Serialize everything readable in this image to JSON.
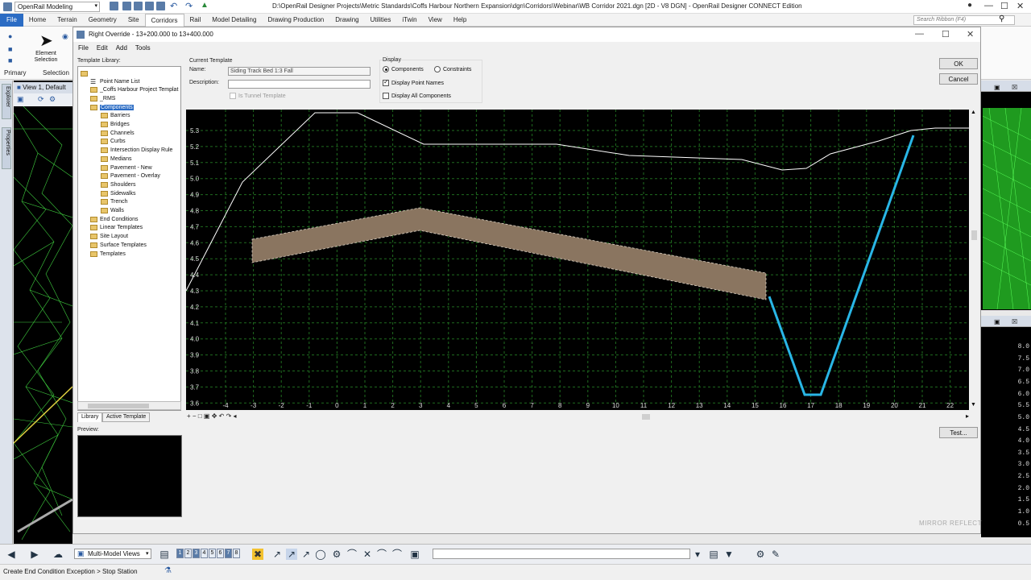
{
  "window": {
    "workspace": "OpenRail Modeling",
    "title": "D:\\OpenRail Designer Projects\\Metric Standards\\Coffs Harbour Northern Expansion\\dgn\\Corridors\\Webinar\\WB Corridor 2021.dgn [2D - V8 DGN] - OpenRail Designer CONNECT Edition",
    "minimize": "—",
    "maximize": "☐",
    "close": "✕"
  },
  "ribbon": {
    "tabs": [
      "File",
      "Home",
      "Terrain",
      "Geometry",
      "Site",
      "Corridors",
      "Rail",
      "Model Detailing",
      "Drawing Production",
      "Drawing",
      "Utilities",
      "iTwin",
      "View",
      "Help"
    ],
    "active_tab": "Corridors",
    "search_placeholder": "Search Ribbon (F4)",
    "element_selection": "Element Selection",
    "groups": [
      "Primary",
      "Selection"
    ]
  },
  "left_panel": {
    "tabs": [
      "Explorer",
      "Properties"
    ]
  },
  "view1": {
    "title": "View 1, Default"
  },
  "dialog": {
    "title": "Right Override - 13+200.000 to 13+400.000",
    "menu": [
      "File",
      "Edit",
      "Add",
      "Tools"
    ],
    "template_library_label": "Template Library:",
    "tree": [
      {
        "label": "Point Name List",
        "level": 1,
        "icon": "list-icon"
      },
      {
        "label": "_Coffs Harbour Project Templat",
        "level": 1,
        "icon": "folder-icon"
      },
      {
        "label": "_RMS",
        "level": 1,
        "icon": "folder-icon"
      },
      {
        "label": "Components",
        "level": 1,
        "icon": "folder-icon",
        "selected": true
      },
      {
        "label": "Barriers",
        "level": 2,
        "icon": "folder-icon"
      },
      {
        "label": "Bridges",
        "level": 2,
        "icon": "folder-icon"
      },
      {
        "label": "Channels",
        "level": 2,
        "icon": "folder-icon"
      },
      {
        "label": "Curbs",
        "level": 2,
        "icon": "folder-icon"
      },
      {
        "label": "Intersection Display Rule",
        "level": 2,
        "icon": "folder-icon"
      },
      {
        "label": "Medians",
        "level": 2,
        "icon": "folder-icon"
      },
      {
        "label": "Pavement - New",
        "level": 2,
        "icon": "folder-icon"
      },
      {
        "label": "Pavement - Overlay",
        "level": 2,
        "icon": "folder-icon"
      },
      {
        "label": "Shoulders",
        "level": 2,
        "icon": "folder-icon"
      },
      {
        "label": "Sidewalks",
        "level": 2,
        "icon": "folder-icon"
      },
      {
        "label": "Trench",
        "level": 2,
        "icon": "folder-icon"
      },
      {
        "label": "Walls",
        "level": 2,
        "icon": "folder-icon"
      },
      {
        "label": "End Conditions",
        "level": 1,
        "icon": "folder-icon"
      },
      {
        "label": "Linear Templates",
        "level": 1,
        "icon": "folder-icon"
      },
      {
        "label": "Site Layout",
        "level": 1,
        "icon": "folder-icon"
      },
      {
        "label": "Surface Templates",
        "level": 1,
        "icon": "folder-icon"
      },
      {
        "label": "Templates",
        "level": 1,
        "icon": "folder-icon"
      }
    ],
    "bottom_tabs": [
      "Library",
      "Active Template"
    ],
    "active_bottom_tab": "Library",
    "preview_label": "Preview:",
    "current_template": {
      "group_label": "Current Template",
      "name_label": "Name:",
      "name_value": "Siding Track Bed 1:3 Fall",
      "description_label": "Description:",
      "description_value": "",
      "tunnel_label": "Is Tunnel Template",
      "tunnel_checked": false
    },
    "display": {
      "group_label": "Display",
      "components_label": "Components",
      "constraints_label": "Constraints",
      "selected_radio": "Components",
      "point_names_label": "Display Point Names",
      "point_names_checked": true,
      "all_components_label": "Display All Components",
      "all_components_checked": false
    },
    "buttons": {
      "ok": "OK",
      "cancel": "Cancel",
      "test": "Test..."
    },
    "watermarks": {
      "mirror": "MIRROR",
      "reflect": "REFLECT"
    }
  },
  "viewer": {
    "y_labels": [
      "5.3",
      "5.2",
      "5.1",
      "5.0",
      "4.9",
      "4.8",
      "4.7",
      "4.6",
      "4.5",
      "4.4",
      "4.3",
      "4.2",
      "4.1",
      "4.0",
      "3.9",
      "3.8",
      "3.7",
      "3.6"
    ],
    "x_labels": [
      "-4",
      "-3",
      "-2",
      "-1",
      "0",
      "1",
      "2",
      "3",
      "4",
      "5",
      "6",
      "7",
      "8",
      "9",
      "10",
      "11",
      "12",
      "13",
      "14",
      "15",
      "16",
      "17",
      "18",
      "19",
      "20",
      "21",
      "22"
    ],
    "colors": {
      "grid": "#1f6b1f",
      "surface": "#ffffff",
      "component_fill": "#8a7560",
      "end_condition": "#29b6e6"
    }
  },
  "right_ruler": {
    "labels": [
      "8.0",
      "7.5",
      "7.0",
      "6.5",
      "6.0",
      "5.5",
      "5.0",
      "4.5",
      "4.0",
      "3.5",
      "3.0",
      "2.5",
      "2.0",
      "1.5",
      "1.0",
      "0.5"
    ]
  },
  "view_toolbar": {
    "view_select": "Multi-Model Views",
    "view_numbers": [
      "1",
      "2",
      "3",
      "4",
      "5",
      "6",
      "7",
      "8"
    ],
    "active_views": [
      "1",
      "3",
      "7"
    ]
  },
  "status": {
    "text": "Create End Condition Exception > Stop Station"
  }
}
